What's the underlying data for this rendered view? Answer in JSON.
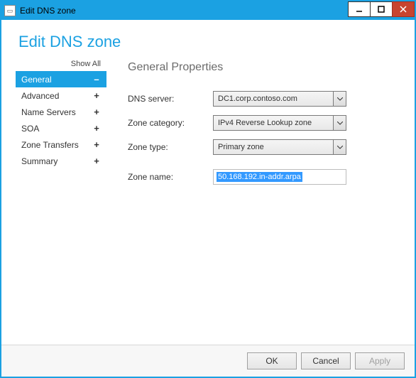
{
  "window": {
    "title": "Edit DNS zone"
  },
  "page_title": "Edit DNS zone",
  "sidebar": {
    "show_all": "Show All",
    "items": [
      {
        "label": "General",
        "symbol": "–",
        "active": true
      },
      {
        "label": "Advanced",
        "symbol": "+",
        "active": false
      },
      {
        "label": "Name Servers",
        "symbol": "+",
        "active": false
      },
      {
        "label": "SOA",
        "symbol": "+",
        "active": false
      },
      {
        "label": "Zone Transfers",
        "symbol": "+",
        "active": false
      },
      {
        "label": "Summary",
        "symbol": "+",
        "active": false
      }
    ]
  },
  "main": {
    "heading": "General Properties",
    "fields": {
      "dns_server": {
        "label": "DNS server:",
        "value": "DC1.corp.contoso.com"
      },
      "zone_category": {
        "label": "Zone category:",
        "value": "IPv4 Reverse Lookup zone"
      },
      "zone_type": {
        "label": "Zone type:",
        "value": "Primary zone"
      },
      "zone_name": {
        "label": "Zone name:",
        "value": "50.168.192.in-addr.arpa"
      }
    }
  },
  "footer": {
    "ok": "OK",
    "cancel": "Cancel",
    "apply": "Apply"
  }
}
